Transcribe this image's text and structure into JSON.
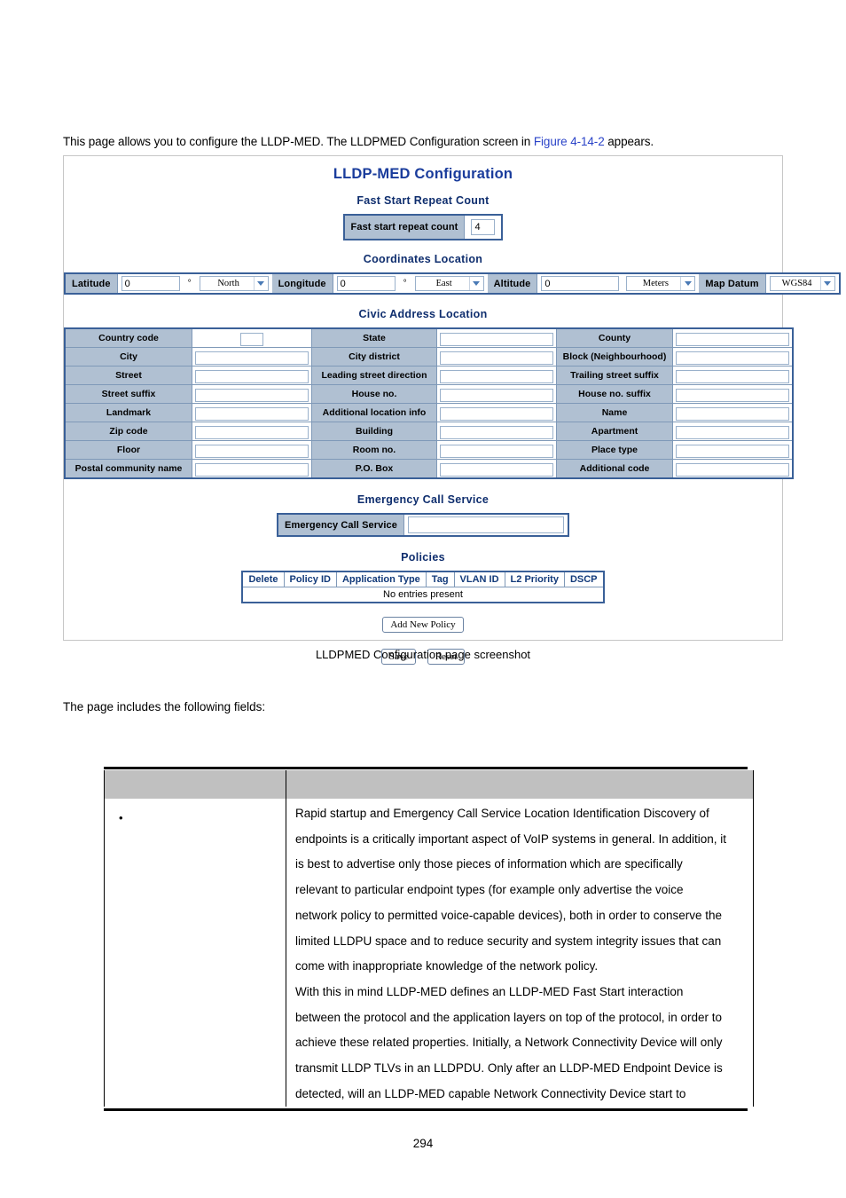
{
  "document": {
    "intro_before": "This page allows you to configure the LLDP-MED. The LLDPMED Configuration screen in ",
    "intro_figref": "Figure 4-14-2",
    "intro_after": " appears.",
    "caption": "LLDPMED Configuration page screenshot",
    "lead_text": "The page includes the following fields:",
    "page_number": "294"
  },
  "figure": {
    "title": "LLDP-MED Configuration",
    "fast_start": {
      "heading": "Fast Start Repeat Count",
      "label": "Fast start repeat count",
      "value": "4"
    },
    "coordinates": {
      "heading": "Coordinates Location",
      "latitude_label": "Latitude",
      "latitude_value": "0",
      "degree_symbol": "°",
      "latitude_direction": "North",
      "longitude_label": "Longitude",
      "longitude_value": "0",
      "longitude_direction": "East",
      "altitude_label": "Altitude",
      "altitude_value": "0",
      "altitude_unit": "Meters",
      "map_datum_label": "Map Datum",
      "map_datum_value": "WGS84"
    },
    "civic": {
      "heading": "Civic Address Location",
      "rows": [
        {
          "c1": "Country code",
          "v1": "",
          "narrow1": true,
          "c2": "State",
          "v2": "",
          "c3": "County",
          "v3": ""
        },
        {
          "c1": "City",
          "v1": "",
          "c2": "City district",
          "v2": "",
          "c3": "Block (Neighbourhood)",
          "v3": ""
        },
        {
          "c1": "Street",
          "v1": "",
          "c2": "Leading street direction",
          "v2": "",
          "c3": "Trailing street suffix",
          "v3": ""
        },
        {
          "c1": "Street suffix",
          "v1": "",
          "c2": "House no.",
          "v2": "",
          "c3": "House no. suffix",
          "v3": ""
        },
        {
          "c1": "Landmark",
          "v1": "",
          "c2": "Additional location info",
          "v2": "",
          "c3": "Name",
          "v3": ""
        },
        {
          "c1": "Zip code",
          "v1": "",
          "c2": "Building",
          "v2": "",
          "c3": "Apartment",
          "v3": ""
        },
        {
          "c1": "Floor",
          "v1": "",
          "c2": "Room no.",
          "v2": "",
          "c3": "Place type",
          "v3": ""
        },
        {
          "c1": "Postal community name",
          "v1": "",
          "c2": "P.O. Box",
          "v2": "",
          "c3": "Additional code",
          "v3": ""
        }
      ]
    },
    "emergency": {
      "heading": "Emergency Call Service",
      "label": "Emergency Call Service",
      "value": ""
    },
    "policies": {
      "heading": "Policies",
      "columns": [
        "Delete",
        "Policy ID",
        "Application Type",
        "Tag",
        "VLAN ID",
        "L2 Priority",
        "DSCP"
      ],
      "empty_text": "No entries present"
    },
    "buttons": {
      "add_new_policy": "Add New Policy",
      "save": "Save",
      "reset": "Reset"
    },
    "colors": {
      "title_blue": "#1a3c9c",
      "label_bg": "#b0c0d2",
      "frame_blue": "#3a6098",
      "link_blue": "#2a43c8",
      "table_header_gray": "#c0c0c0"
    }
  },
  "description_table": {
    "header": {
      "col1": "",
      "col2": ""
    },
    "row": {
      "bullet": "•",
      "paragraph_lines": [
        "Rapid startup and Emergency Call Service Location Identification Discovery of",
        "endpoints is a critically important aspect of VoIP systems in general. In addition, it",
        "is best to advertise only those pieces of information which are specifically",
        "relevant to particular endpoint types (for example only advertise the voice",
        "network policy to permitted voice-capable devices), both in order to conserve the",
        "limited LLDPU space and to reduce security and system integrity issues that can",
        "come with inappropriate knowledge of the network policy.",
        "With this in mind LLDP-MED defines an LLDP-MED Fast Start interaction",
        "between the protocol and the application layers on top of the protocol, in order to",
        "achieve these related properties. Initially, a Network Connectivity Device will only",
        "transmit LLDP TLVs in an LLDPDU. Only after an LLDP-MED Endpoint Device is",
        "detected, will an LLDP-MED capable Network Connectivity Device start to"
      ]
    }
  }
}
